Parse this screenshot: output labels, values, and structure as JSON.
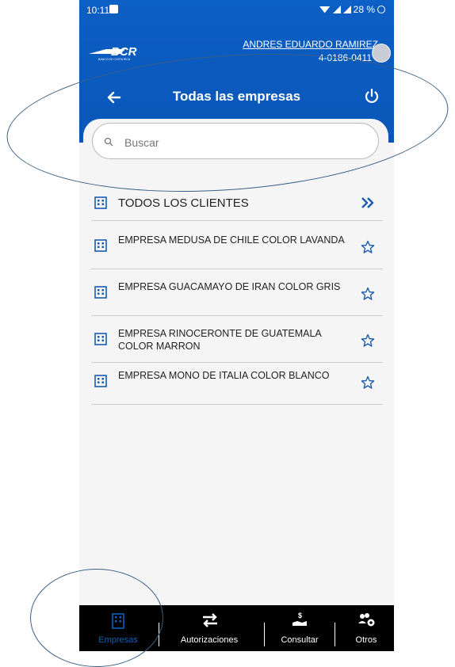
{
  "status_bar": {
    "time": "10:11",
    "battery": "28 %"
  },
  "user": {
    "name": "ANDRES EDUARDO RAMIREZ",
    "id": "4-0186-0411"
  },
  "logo": {
    "text": "BCR",
    "tagline": "BANCO DE COSTA RICA"
  },
  "header": {
    "title": "Todas las empresas"
  },
  "search": {
    "placeholder": "Buscar"
  },
  "all_clients": {
    "label": "TODOS LOS CLIENTES"
  },
  "companies": [
    {
      "name": "EMPRESA MEDUSA DE CHILE COLOR LAVANDA"
    },
    {
      "name": "EMPRESA GUACAMAYO DE IRAN COLOR GRIS"
    },
    {
      "name": "EMPRESA RINOCERONTE DE GUATEMALA COLOR MARRON"
    },
    {
      "name": "EMPRESA MONO DE ITALIA COLOR BLANCO"
    }
  ],
  "bottom_nav": [
    {
      "label": "Empresas",
      "icon": "building-icon",
      "active": true
    },
    {
      "label": "Autorizaciones",
      "icon": "transfer-arrows-icon",
      "active": false
    },
    {
      "label": "Consultar",
      "icon": "hand-money-icon",
      "active": false
    },
    {
      "label": "Otros",
      "icon": "people-gear-icon",
      "active": false
    }
  ],
  "colors": {
    "primary": "#0c5fc4",
    "nav_bg": "#000000",
    "active_nav": "#0d5fc0",
    "annotation": "#3a5f86"
  }
}
